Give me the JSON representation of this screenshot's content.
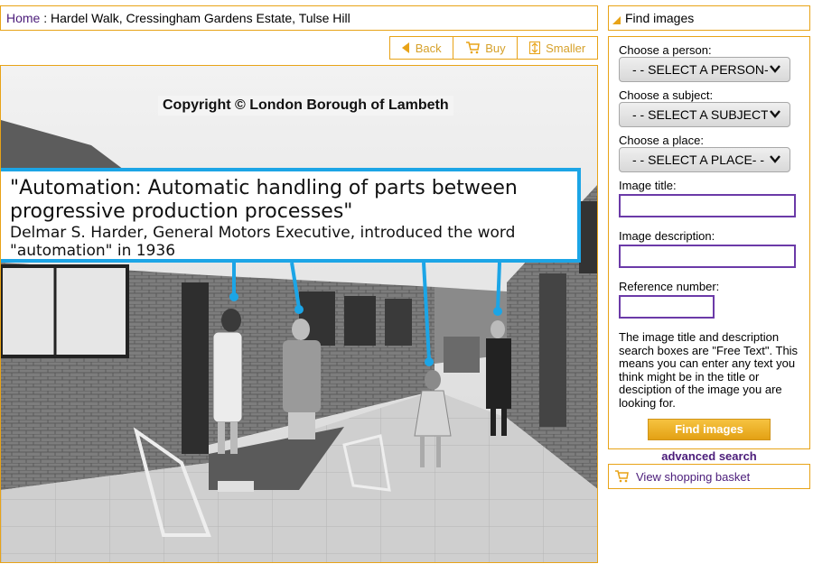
{
  "breadcrumb": {
    "home": "Home",
    "separator": ":",
    "current": "Hardel Walk, Cressingham Gardens Estate, Tulse Hill"
  },
  "toolbar": {
    "back": "Back",
    "buy": "Buy",
    "smaller": "Smaller"
  },
  "image": {
    "copyright": "Copyright © London Borough of Lambeth",
    "quote_title": "\"Automation: Automatic handling of parts between progressive production processes\"",
    "quote_attribution": "Delmar S. Harder, General Motors Executive, introduced the word \"automation\" in 1936"
  },
  "sidebar": {
    "header": "Find images",
    "person_label": "Choose a person:",
    "person_value": "- - SELECT A PERSON- -",
    "subject_label": "Choose a subject:",
    "subject_value": "- - SELECT A SUBJECT- -",
    "place_label": "Choose a place:",
    "place_value": "- - SELECT A PLACE- -",
    "title_label": "Image title:",
    "description_label": "Image description:",
    "reference_label": "Reference number:",
    "help_text": "The image title and description search boxes are \"Free Text\". This means you can enter any text you think might be in the title or desciption of the image you are looking for.",
    "find_button": "Find images",
    "advanced_link": "advanced search"
  },
  "basket": {
    "label": "View shopping basket"
  },
  "colors": {
    "border": "#e8a317",
    "link": "#4b1c7a",
    "accent_blue": "#1ca5e6",
    "button": "#f0b12a"
  }
}
